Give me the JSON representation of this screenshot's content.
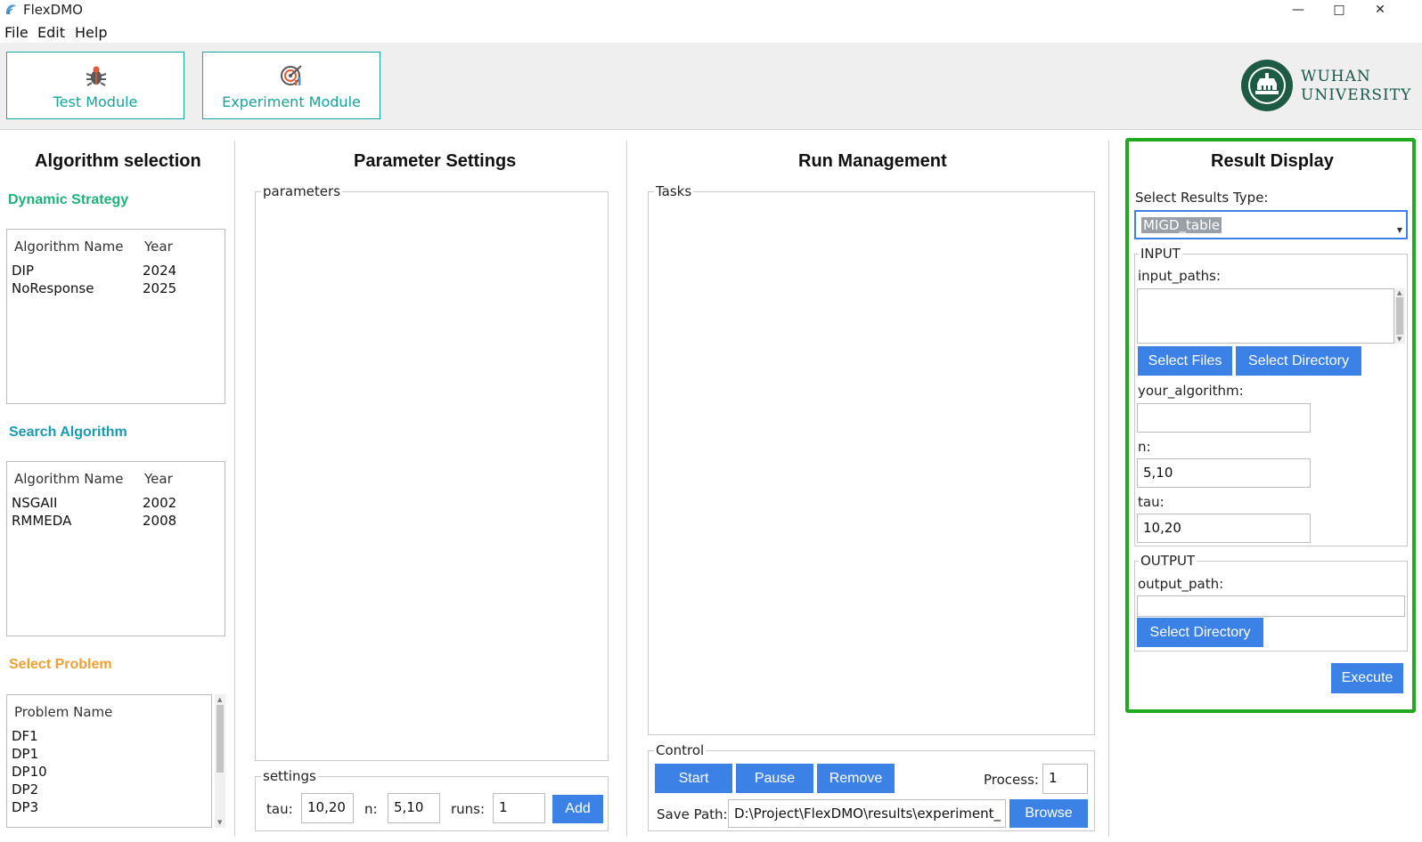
{
  "window": {
    "title": "FlexDMO"
  },
  "menu": [
    "File",
    "Edit",
    "Help"
  ],
  "modules": [
    {
      "label": "Test Module",
      "icon": "bug-icon"
    },
    {
      "label": "Experiment Module",
      "icon": "target-chart-icon"
    }
  ],
  "brand": {
    "line1": "WUHAN",
    "line2": "UNIVERSITY"
  },
  "colors": {
    "accent": "#3c82e6",
    "teal": "#16a39a",
    "strategy": "#1cb37a",
    "search": "#1a9ab0",
    "problem": "#f0a030",
    "highlight": "#1faa1f"
  },
  "algo": {
    "title": "Algorithm selection",
    "dynamic": {
      "label": "Dynamic Strategy",
      "headers": [
        "Algorithm Name",
        "Year"
      ],
      "rows": [
        [
          "DIP",
          "2024"
        ],
        [
          "NoResponse",
          "2025"
        ]
      ]
    },
    "search": {
      "label": "Search Algorithm",
      "headers": [
        "Algorithm Name",
        "Year"
      ],
      "rows": [
        [
          "NSGAII",
          "2002"
        ],
        [
          "RMMEDA",
          "2008"
        ]
      ]
    },
    "problem": {
      "label": "Select Problem",
      "header": "Problem Name",
      "rows": [
        "DF1",
        "DP1",
        "DP10",
        "DP2",
        "DP3"
      ]
    }
  },
  "params": {
    "title": "Parameter Settings",
    "group": "parameters",
    "settings": {
      "group": "settings",
      "tau_label": "tau:",
      "tau": "10,20",
      "n_label": "n:",
      "n": "5,10",
      "runs_label": "runs:",
      "runs": "1",
      "add": "Add"
    }
  },
  "run": {
    "title": "Run Management",
    "tasks": "Tasks",
    "control": {
      "group": "Control",
      "start": "Start",
      "pause": "Pause",
      "remove": "Remove",
      "process_label": "Process:",
      "process": "1",
      "save_label": "Save Path:",
      "save_path": "D:\\Project\\FlexDMO\\results\\experiment_",
      "browse": "Browse"
    }
  },
  "result": {
    "title": "Result Display",
    "type_label": "Select Results Type:",
    "type_value": "MIGD_table",
    "input": {
      "group": "INPUT",
      "paths_label": "input_paths:",
      "select_files": "Select Files",
      "select_dir": "Select Directory",
      "algo_label": "your_algorithm:",
      "algo_value": "",
      "n_label": "n:",
      "n": "5,10",
      "tau_label": "tau:",
      "tau": "10,20"
    },
    "output": {
      "group": "OUTPUT",
      "path_label": "output_path:",
      "path_value": "",
      "select_dir": "Select Directory"
    },
    "execute": "Execute"
  }
}
